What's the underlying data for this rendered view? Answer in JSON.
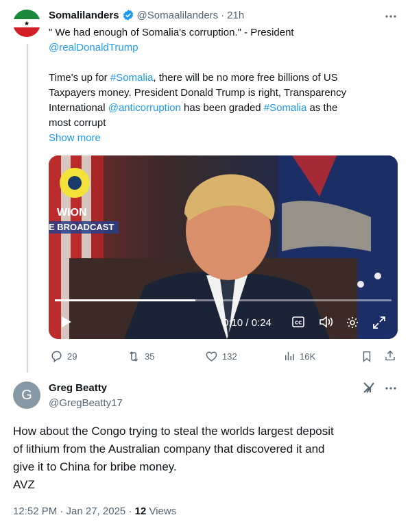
{
  "tweet": {
    "author_name": "Somalilanders",
    "handle": "@Somaalilanders",
    "time": "21h",
    "text_line1": "\" We had enough of Somalia's corruption.\" - President",
    "mention_trump": "@realDonaldTrump",
    "p2_a": "Time's up for ",
    "hashtag_somalia": "#Somalia",
    "p2_b": ", there will be no more free billions of US",
    "p2_c": "Taxpayers money. President Donald Trump is right, Transparency",
    "p2_d": "International ",
    "mention_anti": "@anticorruption",
    "p2_e": " has been graded ",
    "p2_f": " as the",
    "p2_g": "most corrupt",
    "show_more": "Show more",
    "video": {
      "logo_text1": "WION",
      "logo_text2": "E BROADCAST",
      "time": "0:10 / 0:24",
      "progress": 0.4167
    },
    "actions": {
      "replies": "29",
      "retweets": "35",
      "likes": "132",
      "views": "16K"
    }
  },
  "reply": {
    "avatar_letter": "G",
    "author_name": "Greg Beatty",
    "handle": "@GregBeatty17",
    "text": [
      "How about the Congo trying to steal the worlds largest deposit",
      "of lithium from the Australian company that discovered it and",
      "give it to China for bribe money.",
      "AVZ"
    ],
    "time": "12:52 PM · Jan 27, 2025 · ",
    "views_count": "12",
    "views_label": " Views"
  },
  "colors": {
    "accent": "#1d9bf0",
    "muted": "#536471",
    "verified": "#1d9bf0"
  }
}
